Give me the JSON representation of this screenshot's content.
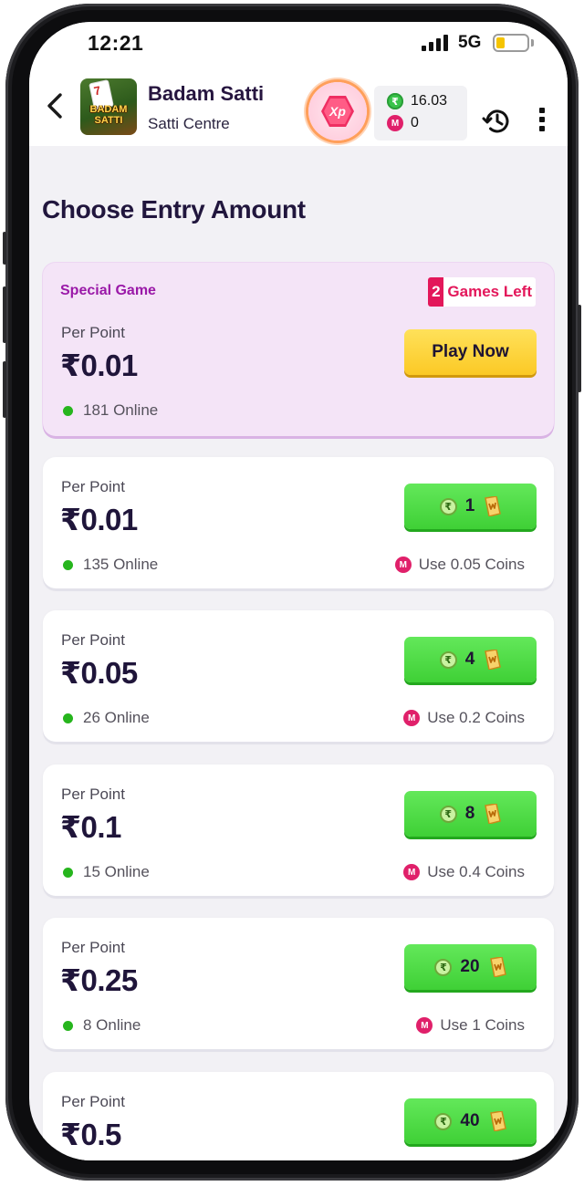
{
  "status_bar": {
    "time": "12:21",
    "network": "5G"
  },
  "header": {
    "logo_card": "7",
    "logo_text_line1": "BADAM",
    "logo_text_line2": "SATTI",
    "title": "Badam Satti",
    "subtitle": "Satti Centre",
    "xp_label": "Xp",
    "wallet_cash": "16.03",
    "wallet_coins": "0"
  },
  "section_title": "Choose Entry Amount",
  "special": {
    "label": "Special Game",
    "games_left_count": "2",
    "games_left_text": "Games Left",
    "per_point_label": "Per Point",
    "amount": "₹0.01",
    "online": "181 Online",
    "button": "Play Now"
  },
  "tables": [
    {
      "per_point_label": "Per Point",
      "amount": "₹0.01",
      "online": "135 Online",
      "entry": "1",
      "coins": "Use 0.05 Coins"
    },
    {
      "per_point_label": "Per Point",
      "amount": "₹0.05",
      "online": "26 Online",
      "entry": "4",
      "coins": "Use 0.2 Coins"
    },
    {
      "per_point_label": "Per Point",
      "amount": "₹0.1",
      "online": "15 Online",
      "entry": "8",
      "coins": "Use 0.4 Coins"
    },
    {
      "per_point_label": "Per Point",
      "amount": "₹0.25",
      "online": "8 Online",
      "entry": "20",
      "coins": "Use 1 Coins"
    },
    {
      "per_point_label": "Per Point",
      "amount": "₹0.5",
      "online": "",
      "entry": "40",
      "coins": ""
    }
  ],
  "icons": {
    "back": "back-arrow-icon",
    "xp": "xp-badge-icon",
    "cash": "rupee-coin-icon",
    "coins": "m-coin-icon",
    "history": "history-icon",
    "more": "more-vertical-icon",
    "ticket": "ticket-icon"
  },
  "colors": {
    "title": "#21163d",
    "special_bg": "#f4e4f7",
    "special_label": "#9a19a8",
    "accent_pink": "#e3175a",
    "play_button": "#fbc925",
    "entry_button": "#3fd036",
    "online_dot": "#26b51d"
  }
}
